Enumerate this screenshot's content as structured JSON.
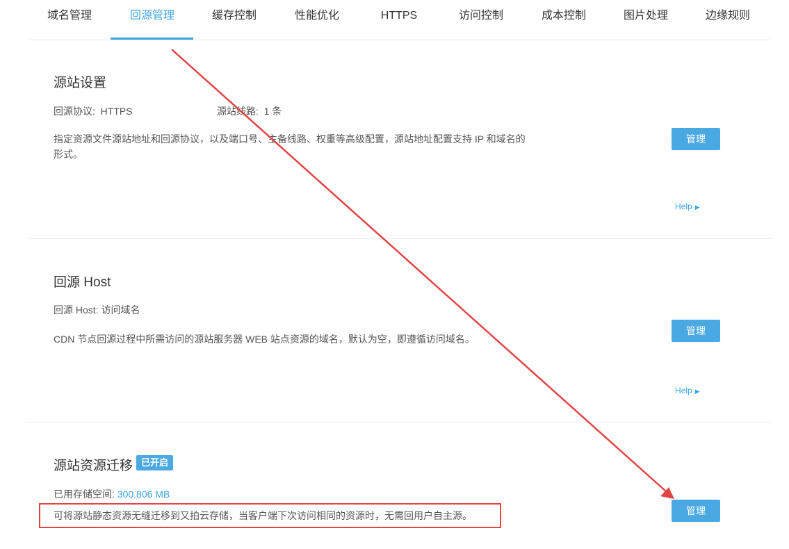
{
  "tabs": [
    {
      "label": "域名管理",
      "active": false
    },
    {
      "label": "回源管理",
      "active": true
    },
    {
      "label": "缓存控制",
      "active": false
    },
    {
      "label": "性能优化",
      "active": false
    },
    {
      "label": "HTTPS",
      "active": false
    },
    {
      "label": "访问控制",
      "active": false
    },
    {
      "label": "成本控制",
      "active": false
    },
    {
      "label": "图片处理",
      "active": false
    },
    {
      "label": "边缘规则",
      "active": false
    }
  ],
  "origin_settings": {
    "title": "源站设置",
    "protocol_label": "回源协议:",
    "protocol_value": "HTTPS",
    "lines_label": "源站线路:",
    "lines_value": "1 条",
    "description": "指定资源文件源站地址和回源协议，以及端口号、主备线路、权重等高级配置，源站地址配置支持 IP 和域名的形式。",
    "manage_label": "管理",
    "help_label": "Help"
  },
  "origin_host": {
    "title": "回源 Host",
    "host_label": "回源 Host:",
    "host_value": "访问域名",
    "description": "CDN 节点回源过程中所需访问的源站服务器 WEB 站点资源的域名，默认为空，即遵循访问域名。",
    "manage_label": "管理",
    "help_label": "Help"
  },
  "migration": {
    "title": "源站资源迁移",
    "status_badge": "已开启",
    "storage_label": "已用存储空间:",
    "storage_value": "300.806 MB",
    "description": "可将源站静态资源无缝迁移到又拍云存储，当客户端下次访问相同的资源时，无需回用户自主源。",
    "manage_label": "管理"
  },
  "colors": {
    "accent": "#3ba4e0",
    "button": "#4aa8e2",
    "annotation": "#e24444"
  }
}
